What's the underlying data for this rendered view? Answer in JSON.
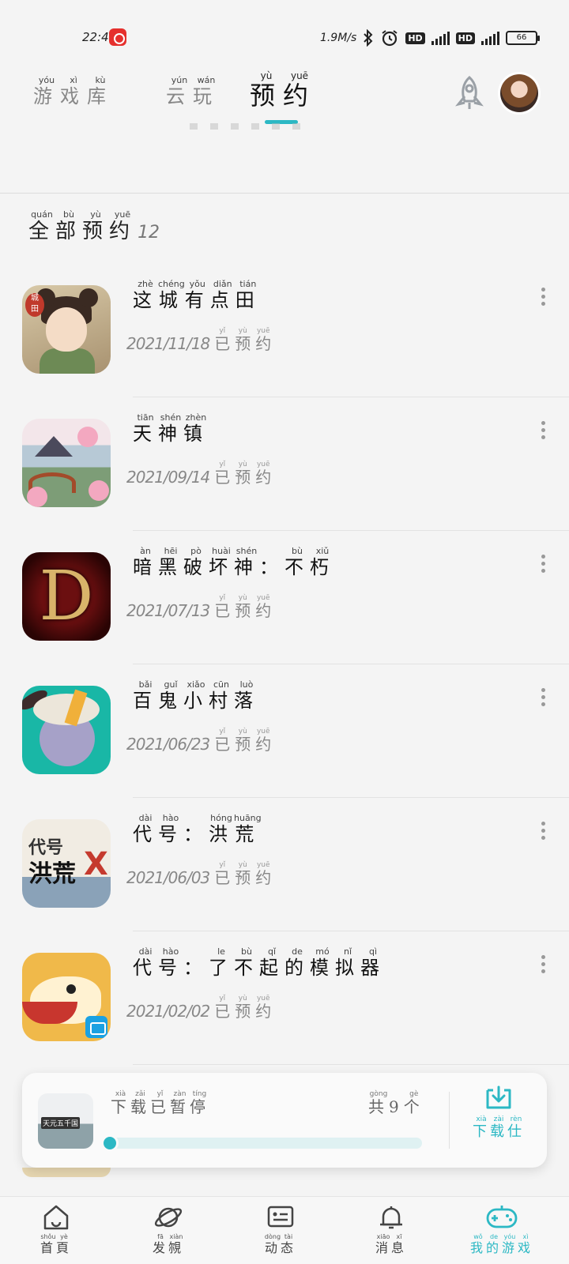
{
  "status_bar": {
    "time": "22:41",
    "net_speed": "1.9M/s",
    "hd1": "HD",
    "hd2": "HD",
    "battery": "66"
  },
  "top_tabs": [
    {
      "chars": [
        "游",
        "戏",
        "库"
      ],
      "pinyin": [
        "yóu",
        "xì",
        "kù"
      ]
    },
    {
      "chars": [
        "云",
        "玩"
      ],
      "pinyin": [
        "yún",
        "wán"
      ]
    },
    {
      "chars": [
        "预",
        "约"
      ],
      "pinyin": [
        "yù",
        "yuē"
      ]
    }
  ],
  "section": {
    "title_chars": [
      "全",
      "部",
      "预",
      "约"
    ],
    "title_pinyin": [
      "quán",
      "bù",
      "yù",
      "yuē"
    ],
    "count": "12"
  },
  "reserved_label": {
    "chars": [
      "已",
      "预",
      "约"
    ],
    "pinyin": [
      "yǐ",
      "yù",
      "yuē"
    ]
  },
  "games": [
    {
      "chars": [
        "这",
        "城",
        "有",
        "点",
        "田"
      ],
      "pinyin": [
        "zhè",
        "chéng",
        "yǒu",
        "diǎn",
        "tián"
      ],
      "date": "2021/11/18",
      "icon": "town-girl-icon"
    },
    {
      "chars": [
        "天",
        "神",
        "镇"
      ],
      "pinyin": [
        "tiān",
        "shén",
        "zhèn"
      ],
      "date": "2021/09/14",
      "icon": "town-bridge-icon"
    },
    {
      "chars": [
        "暗",
        "黑",
        "破",
        "坏",
        "神",
        "：",
        "不",
        "朽"
      ],
      "pinyin": [
        "àn",
        "hēi",
        "pò",
        "huài",
        "shén",
        "",
        "bù",
        "xiǔ"
      ],
      "date": "2021/07/13",
      "icon": "diablo-d-icon"
    },
    {
      "chars": [
        "百",
        "鬼",
        "小",
        "村",
        "落"
      ],
      "pinyin": [
        "bǎi",
        "guǐ",
        "xiǎo",
        "cūn",
        "luò"
      ],
      "date": "2021/06/23",
      "icon": "ghost-village-icon"
    },
    {
      "chars": [
        "代",
        "号",
        "：",
        "洪",
        "荒"
      ],
      "pinyin": [
        "dài",
        "hào",
        "",
        "hóng",
        "huāng"
      ],
      "date": "2021/06/03",
      "icon": "honghuang-icon"
    },
    {
      "chars": [
        "代",
        "号",
        "：",
        "了",
        "不",
        "起",
        "的",
        "模",
        "拟",
        "器"
      ],
      "pinyin": [
        "dài",
        "hào",
        "",
        "le",
        "bù",
        "qǐ",
        "de",
        "mó",
        "nǐ",
        "qì"
      ],
      "date": "2021/02/02",
      "icon": "fox-simulator-icon"
    }
  ],
  "download": {
    "status_chars": [
      "下",
      "载",
      "已",
      "暂",
      "停"
    ],
    "status_pinyin": [
      "xià",
      "zǎi",
      "yǐ",
      "zàn",
      "tíng"
    ],
    "total_chars": [
      "共",
      "9",
      "个"
    ],
    "total_pinyin": [
      "gòng",
      "",
      "gè"
    ],
    "thumb_text": "天元五千国",
    "progress": 0.0,
    "manager_chars": [
      "下",
      "载",
      "仕"
    ],
    "manager_pinyin": [
      "xià",
      "zài",
      "rèn"
    ]
  },
  "bottom_nav": [
    {
      "chars": [
        "首",
        "頁"
      ],
      "pinyin": [
        "shǒu",
        "yè"
      ],
      "icon": "home-icon",
      "active": false
    },
    {
      "chars": [
        "发",
        "覙"
      ],
      "pinyin": [
        "fā",
        "xiàn"
      ],
      "icon": "discover-planet-icon",
      "active": false
    },
    {
      "chars": [
        "动",
        "态"
      ],
      "pinyin": [
        "dòng",
        "tài"
      ],
      "icon": "feed-card-icon",
      "active": false
    },
    {
      "chars": [
        "消",
        "息"
      ],
      "pinyin": [
        "xiāo",
        "xī"
      ],
      "icon": "bell-icon",
      "active": false
    },
    {
      "chars": [
        "我",
        "的",
        "游",
        "戏"
      ],
      "pinyin": [
        "wǒ",
        "de",
        "yóu",
        "xì"
      ],
      "icon": "gamepad-icon",
      "active": true
    }
  ],
  "colors": {
    "accent": "#2cb8c4",
    "text": "#222222",
    "muted": "#888888",
    "background": "#f4f4f4"
  }
}
